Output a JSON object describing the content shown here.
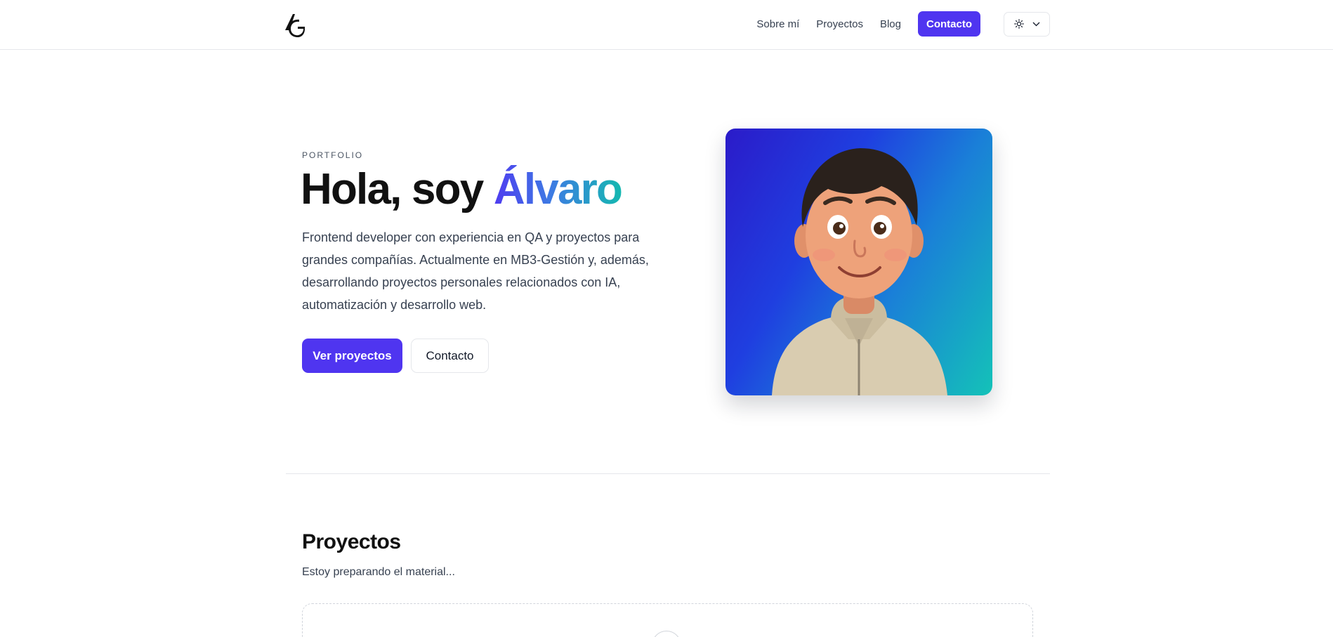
{
  "header": {
    "logo_text": "AG",
    "nav": [
      "Sobre mí",
      "Proyectos",
      "Blog"
    ],
    "cta_label": "Contacto",
    "theme_icon": "sun-icon",
    "theme_chevron": "chevron-down-icon"
  },
  "hero": {
    "eyebrow": "PORTFOLIO",
    "title_prefix": "Hola, soy ",
    "title_accent": "Álvaro",
    "description": "Frontend developer con experiencia en QA y proyectos para grandes compañías. Actualmente en MB3-Gestión y, además, desarrollando proyectos personales relacionados con IA, automatización y desarrollo web.",
    "primary_button": "Ver proyectos",
    "secondary_button": "Contacto"
  },
  "projects": {
    "title": "Proyectos",
    "subtitle": "Estoy preparando el material..."
  },
  "colors": {
    "accent": "#4f35f0",
    "gradient_start": "#4f3cf0",
    "gradient_end": "#14b8b0",
    "border": "#e5e7eb"
  }
}
